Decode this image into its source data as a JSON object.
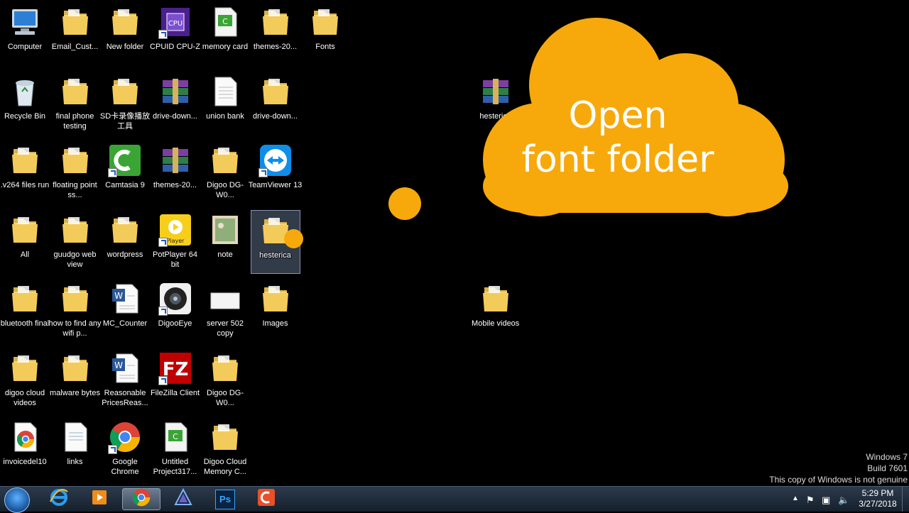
{
  "desktop": {
    "icons": [
      {
        "label": "Computer",
        "type": "computer-icon"
      },
      {
        "label": "Email_Cust...",
        "type": "folder-icon"
      },
      {
        "label": "New folder",
        "type": "folder-icon"
      },
      {
        "label": "CPUID CPU-Z",
        "type": "cpuz-icon"
      },
      {
        "label": "memory card",
        "type": "camtasia-project-icon"
      },
      {
        "label": "themes-20...",
        "type": "folder-icon"
      },
      {
        "label": "Fonts",
        "type": "folder-icon"
      },
      {
        "label": "Recycle Bin",
        "type": "recycle-bin-icon"
      },
      {
        "label": "final phone testing",
        "type": "folder-icon"
      },
      {
        "label": "SD卡录像播放工具",
        "type": "folder-icon"
      },
      {
        "label": "drive-down...",
        "type": "winrar-archive-icon"
      },
      {
        "label": "union bank",
        "type": "document-icon"
      },
      {
        "label": "drive-down...",
        "type": "folder-icon"
      },
      {
        "label": "hesterica",
        "type": "winrar-archive-icon"
      },
      {
        "label": ".v264 files run",
        "type": "folder-icon"
      },
      {
        "label": "floating point ss...",
        "type": "folder-icon"
      },
      {
        "label": "Camtasia 9",
        "type": "camtasia-icon"
      },
      {
        "label": "themes-20...",
        "type": "winrar-archive-icon"
      },
      {
        "label": "Digoo DG-W0...",
        "type": "folder-icon"
      },
      {
        "label": "TeamViewer 13",
        "type": "teamviewer-icon"
      },
      {
        "label": "All",
        "type": "folder-icon"
      },
      {
        "label": "guudgo web view",
        "type": "folder-icon"
      },
      {
        "label": "wordpress",
        "type": "folder-icon"
      },
      {
        "label": "PotPlayer 64 bit",
        "type": "potplayer-icon"
      },
      {
        "label": "note",
        "type": "image-file-icon"
      },
      {
        "label": "hesterica",
        "type": "folder-icon",
        "selected": true
      },
      {
        "label": "bluetooth final",
        "type": "folder-icon"
      },
      {
        "label": "how to find any wifi p...",
        "type": "folder-icon"
      },
      {
        "label": "MC_Counter",
        "type": "word-document-icon"
      },
      {
        "label": "DigooEye",
        "type": "digooeye-icon"
      },
      {
        "label": "server 502 copy",
        "type": "blank-file-icon"
      },
      {
        "label": "Images",
        "type": "folder-icon"
      },
      {
        "label": "Mobile videos",
        "type": "folder-icon"
      },
      {
        "label": "digoo cloud videos",
        "type": "folder-icon"
      },
      {
        "label": "malware bytes",
        "type": "folder-icon"
      },
      {
        "label": "Reasonable PricesReas...",
        "type": "word-document-icon"
      },
      {
        "label": "FileZilla Client",
        "type": "filezilla-icon"
      },
      {
        "label": "Digoo DG-W0...",
        "type": "folder-icon"
      },
      {
        "label": "invoicedel10",
        "type": "chrome-document-icon"
      },
      {
        "label": "links",
        "type": "text-file-icon"
      },
      {
        "label": "Google Chrome",
        "type": "chrome-icon"
      },
      {
        "label": "Untitled Project317...",
        "type": "camtasia-project-icon"
      },
      {
        "label": "Digoo Cloud Memory C...",
        "type": "folder-icon"
      }
    ]
  },
  "overlay": {
    "cloud_text_line1": "Open",
    "cloud_text_line2": "font folder",
    "accent_color": "#f7a90b"
  },
  "watermark": {
    "line1": "Windows 7",
    "line2": "Build 7601",
    "line3": "This copy of Windows is not genuine"
  },
  "taskbar": {
    "buttons": [
      {
        "name": "internet-explorer-icon"
      },
      {
        "name": "media-player-icon"
      },
      {
        "name": "chrome-icon",
        "active": true
      },
      {
        "name": "app-icon"
      },
      {
        "name": "photoshop-icon",
        "label": "Ps"
      },
      {
        "name": "camtasia-icon"
      }
    ],
    "tray": {
      "time": "5:29 PM",
      "date": "3/27/2018"
    }
  }
}
